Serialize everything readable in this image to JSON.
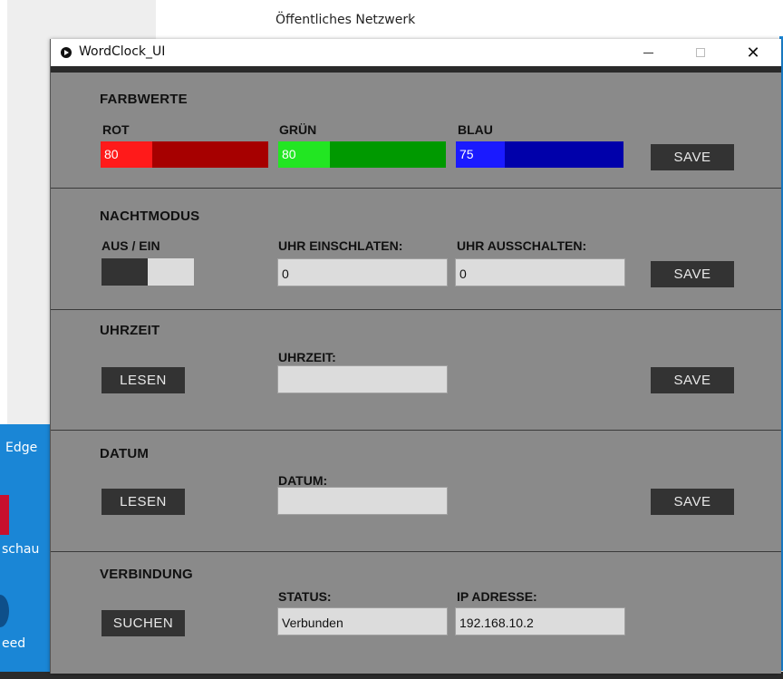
{
  "desktop": {
    "network_label": "Öffentliches Netzwerk",
    "icon_labels": [
      "Edge",
      "schau",
      "eed"
    ]
  },
  "window": {
    "title": "WordClock_UI",
    "controls": {
      "minimize": "—",
      "maximize": "☐",
      "close": "✕"
    }
  },
  "farbwerte": {
    "heading": "FARBWERTE",
    "rot": {
      "label": "ROT",
      "value": "80",
      "fraction": 0.31,
      "track_color": "#a60000",
      "fill_color": "#ff1a1a"
    },
    "gruen": {
      "label": "GRÜN",
      "value": "80",
      "fraction": 0.31,
      "track_color": "#009900",
      "fill_color": "#22e622"
    },
    "blau": {
      "label": "BLAU",
      "value": "75",
      "fraction": 0.29,
      "track_color": "#0000aa",
      "fill_color": "#1a1aff"
    },
    "save": "SAVE"
  },
  "nachtmodus": {
    "heading": "NACHTMODUS",
    "toggle_label": "AUS / EIN",
    "einschalten_label": "UHR EINSCHLATEN:",
    "einschalten_value": "0",
    "ausschalten_label": "UHR AUSSCHALTEN:",
    "ausschalten_value": "0",
    "save": "SAVE"
  },
  "uhrzeit": {
    "heading": "UHRZEIT",
    "read": "LESEN",
    "field_label": "UHRZEIT:",
    "value": "",
    "save": "SAVE"
  },
  "datum": {
    "heading": "DATUM",
    "read": "LESEN",
    "field_label": "DATUM:",
    "value": "",
    "save": "SAVE"
  },
  "verbindung": {
    "heading": "VERBINDUNG",
    "search": "SUCHEN",
    "status_label": "STATUS:",
    "status_value": "Verbunden",
    "ip_label": "IP ADRESSE:",
    "ip_value": "192.168.10.2"
  }
}
